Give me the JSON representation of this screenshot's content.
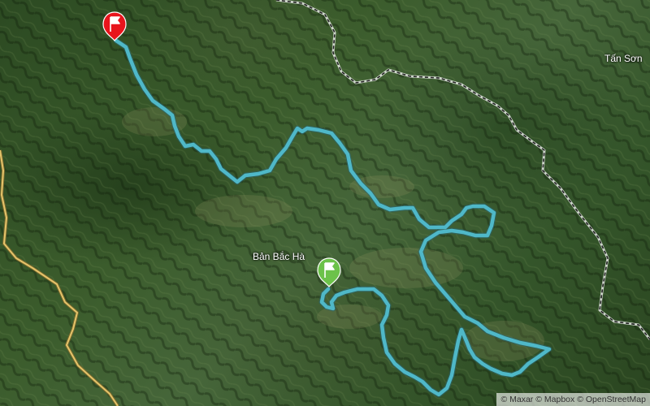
{
  "map": {
    "basemap": "satellite",
    "colors": {
      "route": "#4fb8c8",
      "border": "#222222",
      "road": "#e4c46a",
      "start_flag": "#6cc24a",
      "end_flag": "#e8141c"
    },
    "labels": {
      "ban_bac_ha": "Bản Bắc Hà",
      "tan_son": "Tấn Sơn"
    },
    "markers": {
      "start": {
        "icon": "green-flag-icon"
      },
      "end": {
        "icon": "red-flag-icon"
      }
    }
  },
  "attribution": {
    "copyright": "©",
    "maxar": "Maxar",
    "mapbox": "Mapbox",
    "osm": "OpenStreetMap"
  }
}
